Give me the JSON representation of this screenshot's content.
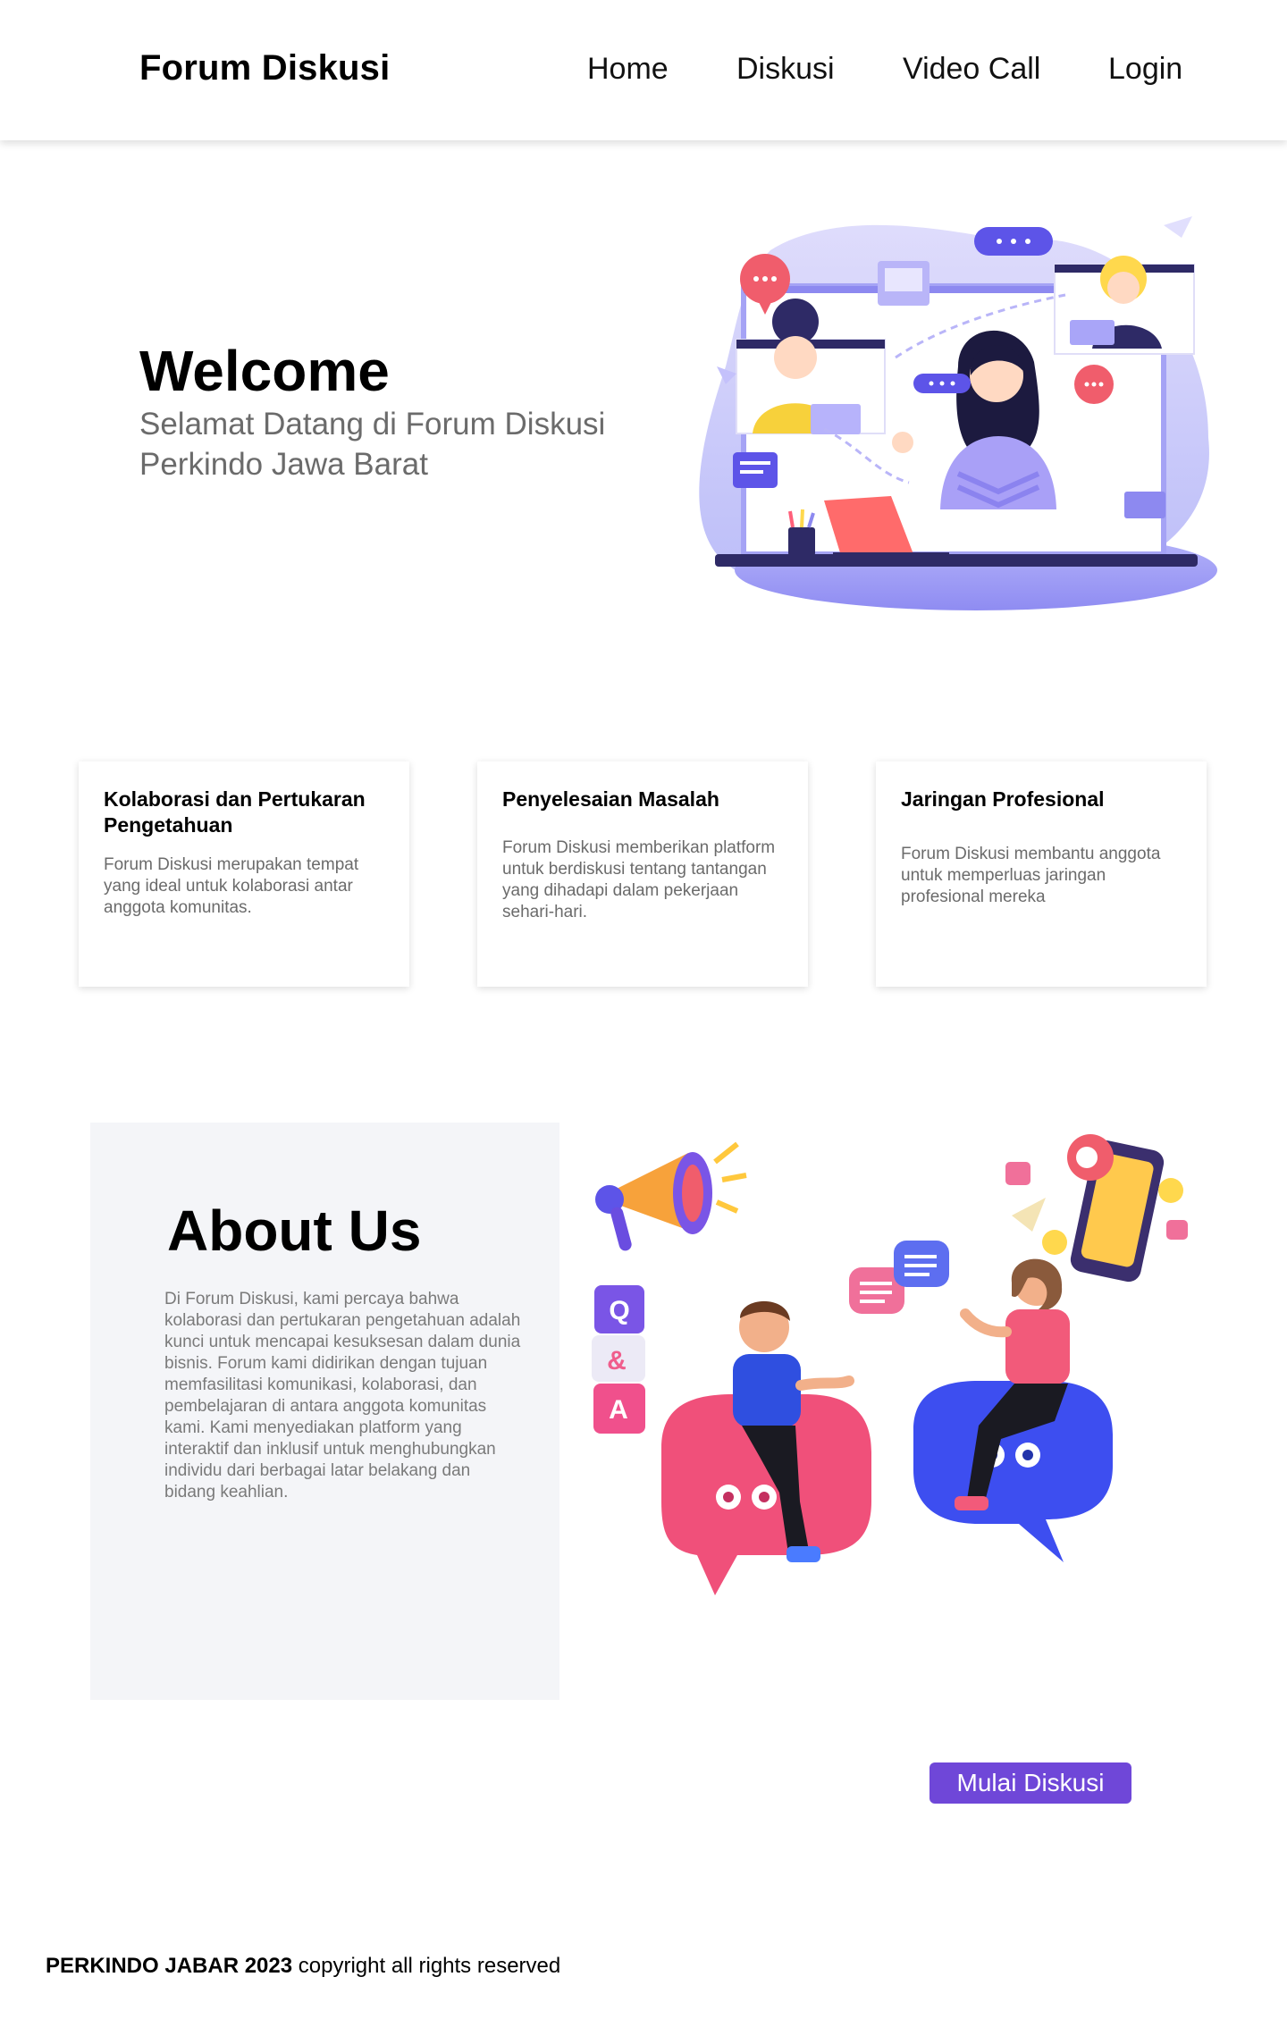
{
  "navbar": {
    "brand": "Forum Diskusi",
    "links": [
      {
        "label": "Home",
        "icon": ""
      },
      {
        "label": "Diskusi"
      },
      {
        "label": "Video Call"
      },
      {
        "label": "Login"
      }
    ]
  },
  "hero": {
    "title": "Welcome",
    "subtitle": "Selamat Datang di Forum Diskusi Perkindo Jawa Barat",
    "illustration": "video-call-illustration"
  },
  "features": [
    {
      "title": "Kolaborasi dan Pertukaran Pengetahuan",
      "text": "Forum Diskusi merupakan tempat yang ideal untuk kolaborasi antar anggota komunitas."
    },
    {
      "title": "Penyelesaian Masalah",
      "text": "Forum Diskusi memberikan platform untuk berdiskusi tentang tantangan yang dihadapi dalam pekerjaan sehari-hari."
    },
    {
      "title": "Jaringan Profesional",
      "text": "Forum Diskusi membantu anggota untuk memperluas jaringan profesional mereka"
    }
  ],
  "about": {
    "title": "About Us",
    "text": "Di Forum Diskusi, kami percaya bahwa kolaborasi dan pertukaran pengetahuan adalah kunci untuk mencapai kesuksesan dalam dunia bisnis. Forum kami didirikan dengan tujuan memfasilitasi komunikasi, kolaborasi, dan pembelajaran di antara anggota komunitas kami. Kami menyediakan platform yang interaktif dan inklusif untuk menghubungkan individu dari berbagai latar belakang dan bidang keahlian.",
    "qa_letters": [
      "Q",
      "&",
      "A"
    ]
  },
  "cta": {
    "label": "Mulai Diskusi",
    "color": "#6f47d8"
  },
  "footer": {
    "org": "PERKINDO JABAR 2023",
    "rest": " copyright all rights reserved"
  }
}
